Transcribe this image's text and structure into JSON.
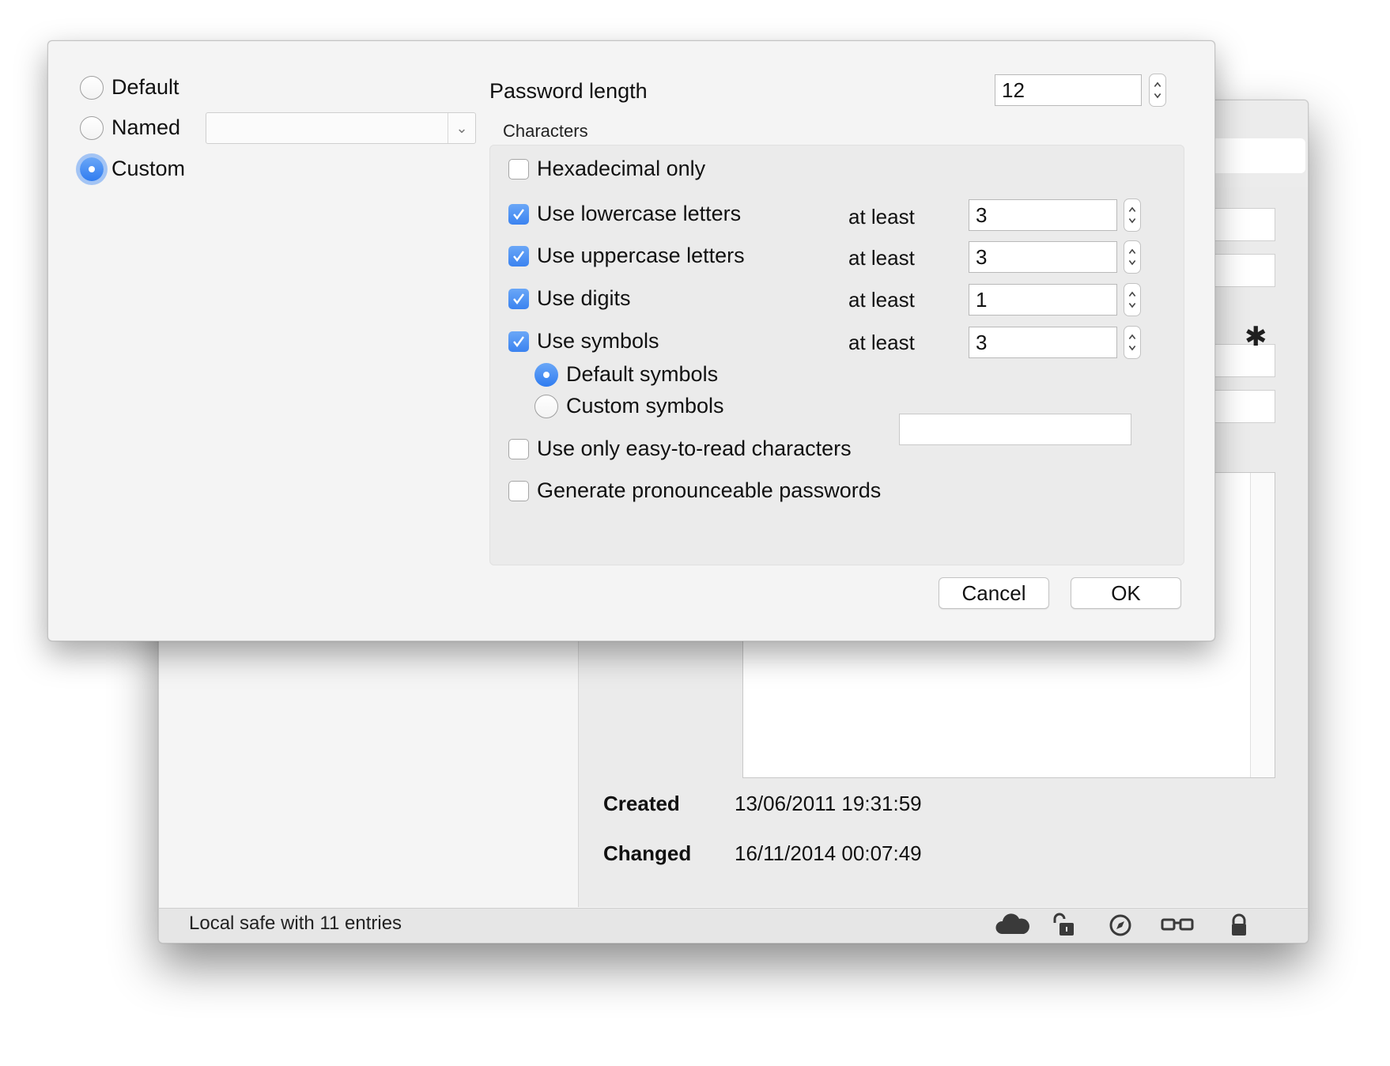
{
  "background_window": {
    "notes_meta": {
      "created_label": "Created",
      "created_value": "13/06/2011 19:31:59",
      "changed_label": "Changed",
      "changed_value": "16/11/2014 00:07:49"
    },
    "statusbar": {
      "text": "Local safe with 11 entries",
      "icons": [
        "cloud-icon",
        "unlocked-icon",
        "compass-icon",
        "glasses-icon",
        "lock-icon"
      ]
    },
    "settings_icon": "gear-icon"
  },
  "dialog": {
    "mode": {
      "default_label": "Default",
      "named_label": "Named",
      "named_value": "",
      "custom_label": "Custom",
      "selected": "Custom"
    },
    "password_length": {
      "label": "Password length",
      "value": "12"
    },
    "characters": {
      "group_label": "Characters",
      "hex_only": {
        "label": "Hexadecimal only",
        "checked": false
      },
      "lowercase": {
        "label": "Use lowercase letters",
        "checked": true,
        "at_least_label": "at least",
        "min": "3"
      },
      "uppercase": {
        "label": "Use uppercase letters",
        "checked": true,
        "at_least_label": "at least",
        "min": "3"
      },
      "digits": {
        "label": "Use digits",
        "checked": true,
        "at_least_label": "at least",
        "min": "1"
      },
      "symbols": {
        "label": "Use symbols",
        "checked": true,
        "at_least_label": "at least",
        "min": "3"
      },
      "default_symbols_label": "Default symbols",
      "custom_symbols_label": "Custom symbols",
      "custom_symbols_value": "",
      "symbols_selected": "Default symbols",
      "easy_to_read": {
        "label": "Use only easy-to-read characters",
        "checked": false
      },
      "pronounceable": {
        "label": "Generate pronounceable passwords",
        "checked": false
      }
    },
    "buttons": {
      "cancel": "Cancel",
      "ok": "OK"
    }
  },
  "colors": {
    "accent": "#3b83f0",
    "dialog_bg": "#f4f4f4",
    "group_bg": "#ebebeb"
  }
}
